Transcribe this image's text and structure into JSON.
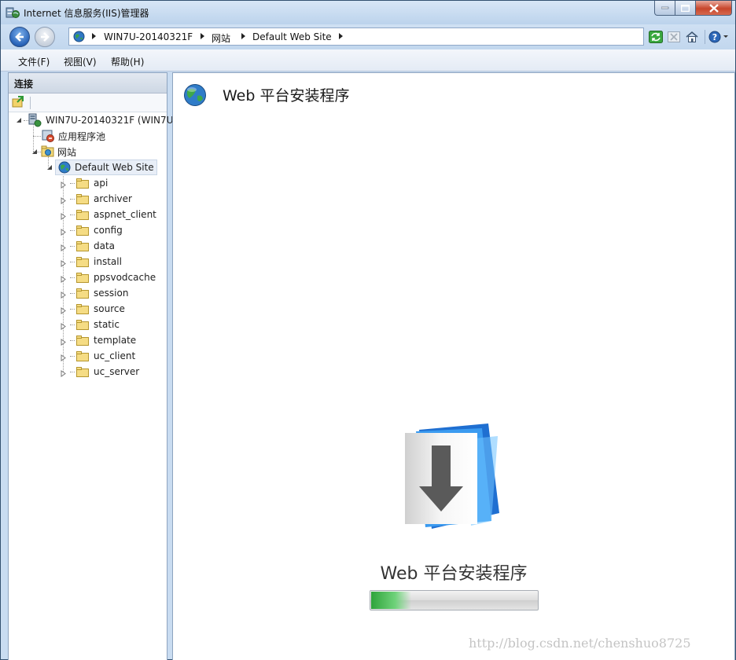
{
  "window": {
    "title": "Internet 信息服务(IIS)管理器"
  },
  "address": {
    "crumbs": [
      "WIN7U-20140321F",
      "网站",
      "Default Web Site"
    ]
  },
  "menu": {
    "items": [
      "文件(F)",
      "视图(V)",
      "帮助(H)"
    ]
  },
  "connections": {
    "header": "连接",
    "server": "WIN7U-20140321F (WIN7U",
    "app_pools": "应用程序池",
    "sites": "网站",
    "site": "Default Web Site",
    "folders": [
      "api",
      "archiver",
      "aspnet_client",
      "config",
      "data",
      "install",
      "ppsvodcache",
      "session",
      "source",
      "static",
      "template",
      "uc_client",
      "uc_server"
    ]
  },
  "main": {
    "title": "Web 平台安装程序",
    "installer_label": "Web 平台安装程序",
    "progress_fraction": 0.12
  },
  "watermark": "http://blog.csdn.net/chenshuo8725",
  "colors": {
    "accent": "#2863b8",
    "progress": "#2fa43b",
    "close_button": "#c7462b"
  }
}
